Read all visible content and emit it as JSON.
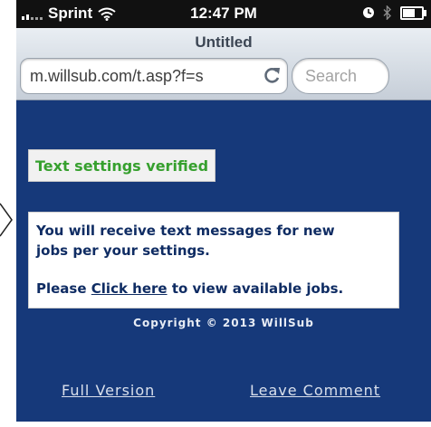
{
  "status_bar": {
    "carrier": "Sprint",
    "time": "12:47 PM"
  },
  "browser": {
    "page_title": "Untitled",
    "url": "m.willsub.com/t.asp?f=s",
    "search_placeholder": "Search"
  },
  "page": {
    "verified_message": "Text settings verified",
    "info_line_1": "You will receive text messages for new",
    "info_line_2": "jobs per your settings.",
    "prompt_prefix": "Please",
    "click_here_link": "Click here",
    "prompt_suffix": "to view available jobs.",
    "copyright": "Copyright © 2013 WillSub",
    "full_version_link": "Full Version",
    "leave_comment_link": "Leave Comment"
  },
  "colors": {
    "page_background": "#16397a",
    "verified_text": "#36a02e",
    "message_text": "#0f2c63"
  },
  "icons": {
    "signal": "signal-bars-icon",
    "wifi": "wifi-icon",
    "clock": "alarm-clock-icon",
    "bluetooth": "bluetooth-icon",
    "battery": "battery-icon",
    "reload": "reload-icon",
    "arrow": "chevron-right-icon"
  }
}
